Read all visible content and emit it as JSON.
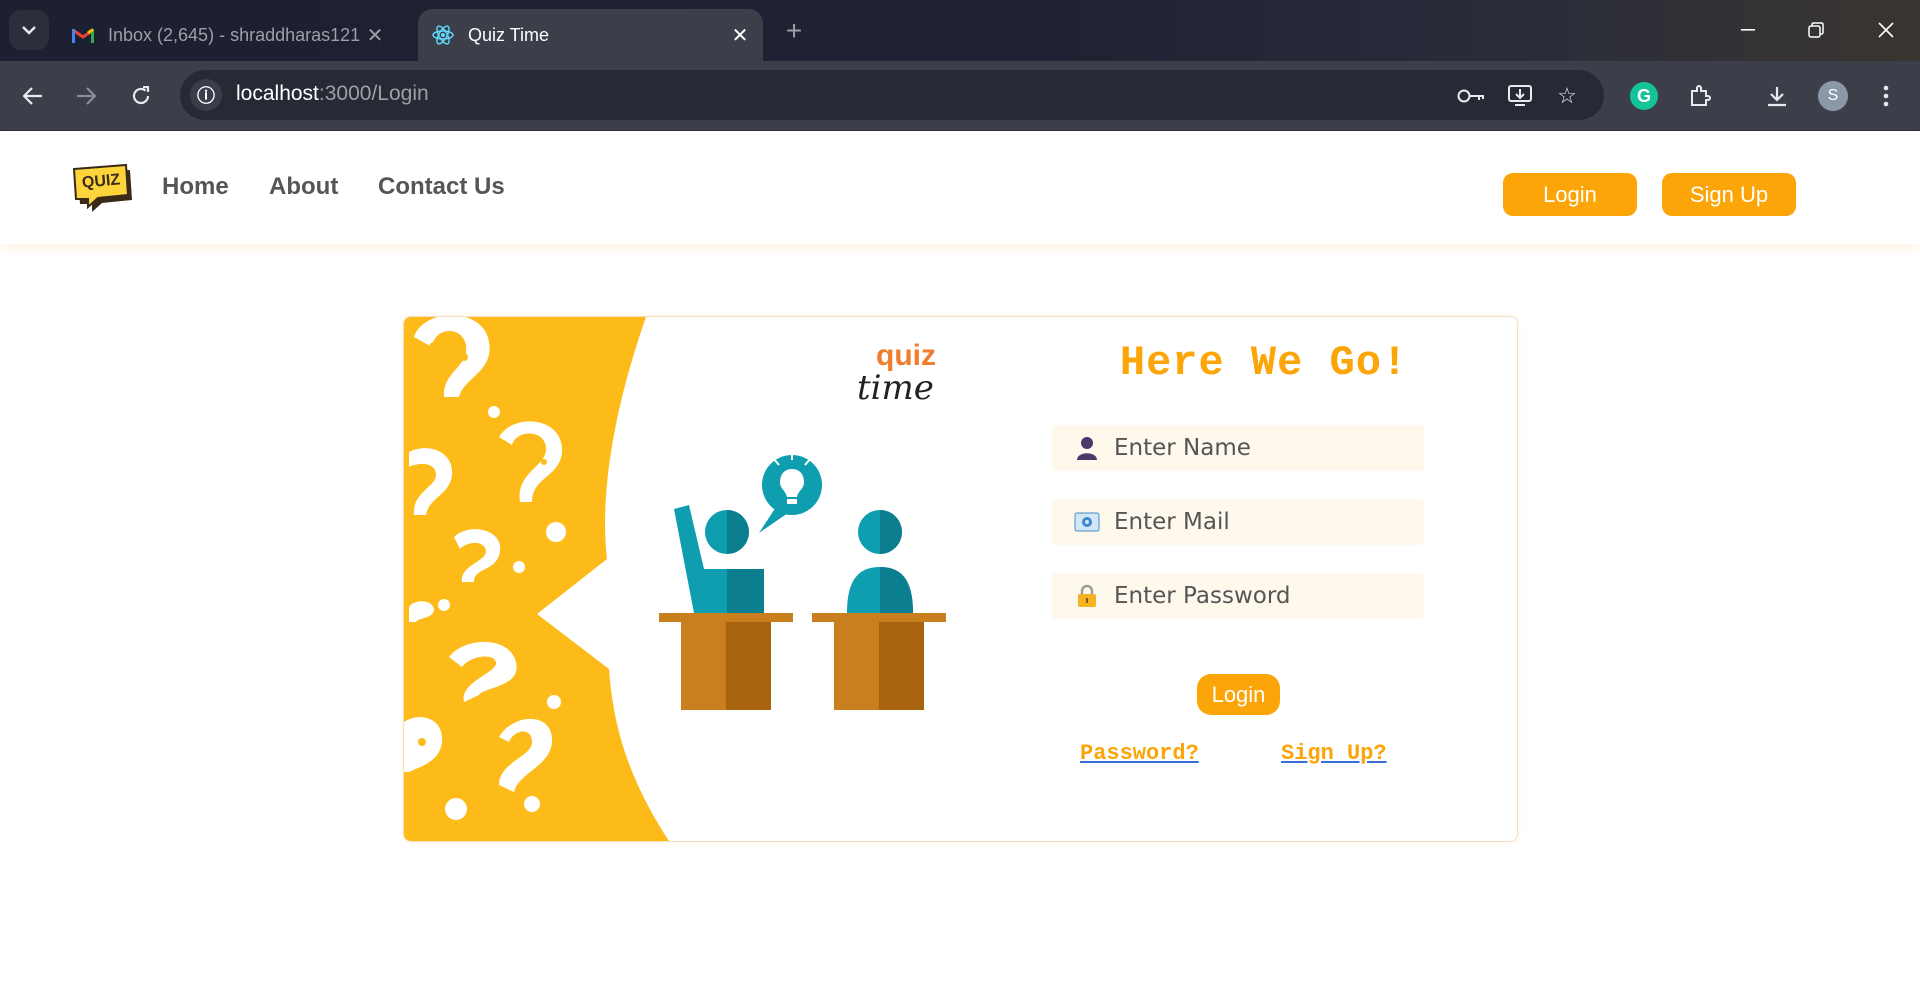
{
  "browser": {
    "tabs": [
      {
        "title": "Inbox (2,645) - shraddharas121",
        "active": false,
        "icon": "gmail-icon"
      },
      {
        "title": "Quiz Time",
        "active": true,
        "icon": "react-icon"
      }
    ],
    "url_host": "localhost",
    "url_path": ":3000/Login",
    "profile_initial": "S"
  },
  "site": {
    "nav": {
      "links": [
        "Home",
        "About",
        "Contact Us"
      ],
      "login_label": "Login",
      "signup_label": "Sign Up"
    },
    "logo_text": "QUIZ",
    "illustration": {
      "brand_top": "quiz",
      "brand_bottom": "time"
    },
    "form": {
      "heading": "Here We Go!",
      "name_placeholder": "Enter Name",
      "mail_placeholder": "Enter Mail",
      "password_placeholder": "Enter Password",
      "login_label": "Login",
      "forgot_label": "Password?",
      "signup_label": "Sign Up?"
    }
  },
  "colors": {
    "accent": "#fba508",
    "illustration_yellow": "#fdbb1a",
    "teal": "#0e9eb0",
    "desk": "#c97f1e"
  }
}
